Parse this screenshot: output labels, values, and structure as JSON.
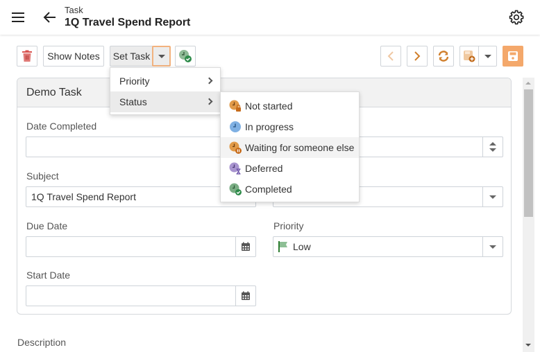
{
  "header": {
    "subtitle": "Task",
    "title": "1Q Travel Spend Report"
  },
  "toolbar": {
    "show_notes_label": "Show Notes",
    "set_task_label": "Set Task"
  },
  "set_task_menu": {
    "items": [
      {
        "label": "Priority"
      },
      {
        "label": "Status"
      }
    ]
  },
  "status_menu": {
    "items": [
      {
        "label": "Not started",
        "icon": "clock-lock-icon",
        "color": "#e19a48"
      },
      {
        "label": "In progress",
        "icon": "clock-icon",
        "color": "#7fb0e3"
      },
      {
        "label": "Waiting for someone else",
        "icon": "clock-pause-icon",
        "color": "#e19a48"
      },
      {
        "label": "Deferred",
        "icon": "clock-hourglass-icon",
        "color": "#a894cf"
      },
      {
        "label": "Completed",
        "icon": "clock-check-icon",
        "color": "#7aad84"
      }
    ]
  },
  "card": {
    "title": "Demo Task"
  },
  "form": {
    "date_completed_label": "Date Completed",
    "date_completed_value": "",
    "subject_label": "Subject",
    "subject_value": "1Q Travel Spend Report",
    "due_date_label": "Due Date",
    "due_date_value": "",
    "priority_label": "Priority",
    "priority_value": "Low",
    "start_date_label": "Start Date",
    "start_date_value": "",
    "description_label": "Description"
  },
  "colors": {
    "accent": "#e08a3c",
    "save_bg": "#f4a86b",
    "delete_red": "#d9534f",
    "priority_low_flag": "#8dbf95"
  }
}
